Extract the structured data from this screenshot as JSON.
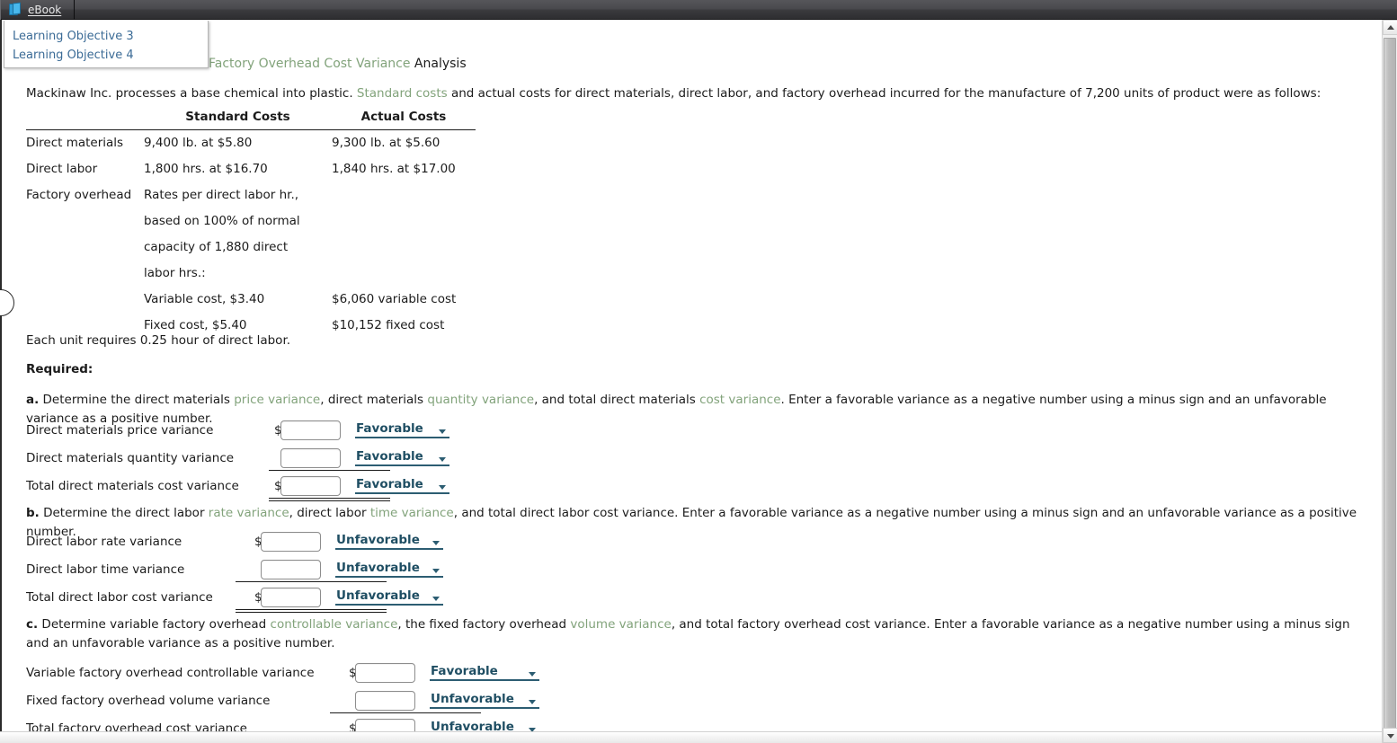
{
  "toolbar": {
    "book_icon": "book-icon",
    "ebook_label": "eBook"
  },
  "flyout": {
    "items": [
      {
        "label": "Learning Objective 3"
      },
      {
        "label": "Learning Objective 4"
      }
    ]
  },
  "doc": {
    "title_link": "Factory Overhead Cost Variance",
    "title_rest": " Analysis",
    "intro_pre": "Mackinaw Inc. processes a base chemical into plastic. ",
    "intro_link": "Standard costs",
    "intro_post": " and actual costs for direct materials, direct labor, and factory overhead incurred for the manufacture of 7,200 units of product were as follows:",
    "each_unit": "Each unit requires 0.25 hour of direct labor.",
    "required": "Required:"
  },
  "cost_table": {
    "headers": [
      "",
      "Standard Costs",
      "Actual Costs"
    ],
    "rows": [
      {
        "label": "Direct materials",
        "standard": "9,400 lb. at $5.80",
        "actual": "9,300 lb. at $5.60",
        "indent": false
      },
      {
        "label": "Direct labor",
        "standard": "1,800 hrs. at $16.70",
        "actual": "1,840 hrs. at $17.00",
        "indent": false
      },
      {
        "label": "Factory overhead",
        "standard": "Rates per direct labor hr.,",
        "actual": "",
        "indent": false
      },
      {
        "label": "",
        "standard": "based on 100% of normal",
        "actual": "",
        "indent": false
      },
      {
        "label": "",
        "standard": "capacity of 1,880 direct",
        "actual": "",
        "indent": false
      },
      {
        "label": "",
        "standard": "labor hrs.:",
        "actual": "",
        "indent": false
      },
      {
        "label": "",
        "standard": "Variable cost, $3.40",
        "actual": "$6,060 variable cost",
        "indent": true
      },
      {
        "label": "",
        "standard": "Fixed cost, $5.40",
        "actual": "$10,152 fixed cost",
        "indent": true
      }
    ]
  },
  "questions": {
    "a": {
      "letter": "a.",
      "t1": "  Determine the direct materials ",
      "l1": "price variance",
      "t2": ", direct materials ",
      "l2": "quantity variance",
      "t3": ", and total direct materials ",
      "l3": "cost variance",
      "t4": ". Enter a favorable variance as a negative number using a minus sign and an unfavorable variance as a positive number.",
      "rows": [
        {
          "label": "Direct materials price variance",
          "dollar": "$",
          "value": "",
          "placeholder": "",
          "select": "Favorable"
        },
        {
          "label": "Direct materials quantity variance",
          "dollar": "",
          "value": "",
          "placeholder": "",
          "select": "Favorable"
        },
        {
          "label": "Total direct materials cost variance",
          "dollar": "$",
          "value": "",
          "placeholder": "",
          "select": "Favorable"
        }
      ]
    },
    "b": {
      "letter": "b.",
      "t1": "  Determine the direct labor ",
      "l1": "rate variance",
      "t2": ", direct labor ",
      "l2": "time variance",
      "t3": ", and total direct labor cost variance. Enter a favorable variance as a negative number using a minus sign and an unfavorable variance as a positive number.",
      "rows": [
        {
          "label": "Direct labor rate variance",
          "dollar": "$",
          "value": "",
          "placeholder": "",
          "select": "Unfavorable"
        },
        {
          "label": "Direct labor time variance",
          "dollar": "",
          "value": "",
          "placeholder": "",
          "select": "Unfavorable"
        },
        {
          "label": "Total direct labor cost variance",
          "dollar": "$",
          "value": "",
          "placeholder": "",
          "select": "Unfavorable"
        }
      ]
    },
    "c": {
      "letter": "c.",
      "t1": "  Determine variable factory overhead ",
      "l1": "controllable variance",
      "t2": ", the fixed factory overhead ",
      "l2": "volume variance",
      "t3": ", and total factory overhead cost variance. Enter a favorable variance as a negative number using a minus sign and an unfavorable variance as a positive number.",
      "rows": [
        {
          "label": "Variable factory overhead controllable variance",
          "dollar": "$",
          "value": "",
          "placeholder": "",
          "select": "Favorable"
        },
        {
          "label": "Fixed factory overhead volume variance",
          "dollar": "",
          "value": "",
          "placeholder": "",
          "select": "Unfavorable"
        },
        {
          "label": "Total factory overhead cost variance",
          "dollar": "$",
          "value": "",
          "placeholder": "",
          "select": "Unfavorable"
        }
      ]
    }
  },
  "select_options": [
    "Favorable",
    "Unfavorable"
  ],
  "colors": {
    "link_green": "#82a37b",
    "select_navy": "#1f4e63",
    "flyout_link": "#3b6b96",
    "toolbar_dark": "#3a3a3d"
  }
}
